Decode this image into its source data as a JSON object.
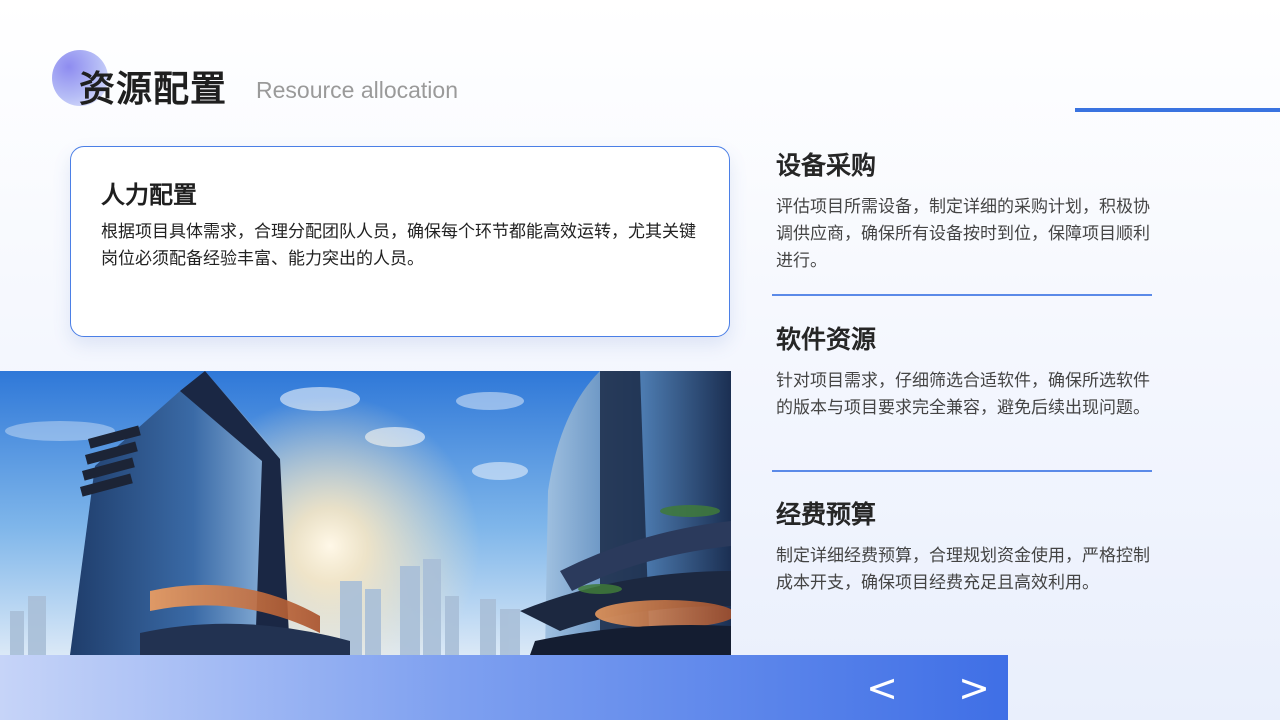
{
  "header": {
    "title": "资源配置",
    "subtitle": "Resource allocation"
  },
  "card": {
    "title": "人力配置",
    "body": "根据项目具体需求，合理分配团队人员，确保每个环节都能高效运转，尤其关键岗位必须配备经验丰富、能力突出的人员。"
  },
  "items": [
    {
      "title": "设备采购",
      "body": "评估项目所需设备，制定详细的采购计划，积极协调供应商，确保所有设备按时到位，保障项目顺利进行。"
    },
    {
      "title": "软件资源",
      "body": "针对项目需求，仔细筛选合适软件，确保所选软件的版本与项目要求完全兼容，避免后续出现问题。"
    },
    {
      "title": "经费预算",
      "body": "制定详细经费预算，合理规划资金使用，严格控制成本开支，确保项目经费充足且高效利用。"
    }
  ],
  "nav": {
    "prev": "<",
    "next": ">"
  },
  "colors": {
    "accent": "#3a73e0",
    "bar_start": "#c6d4f8",
    "bar_end": "#3f6fe6"
  }
}
